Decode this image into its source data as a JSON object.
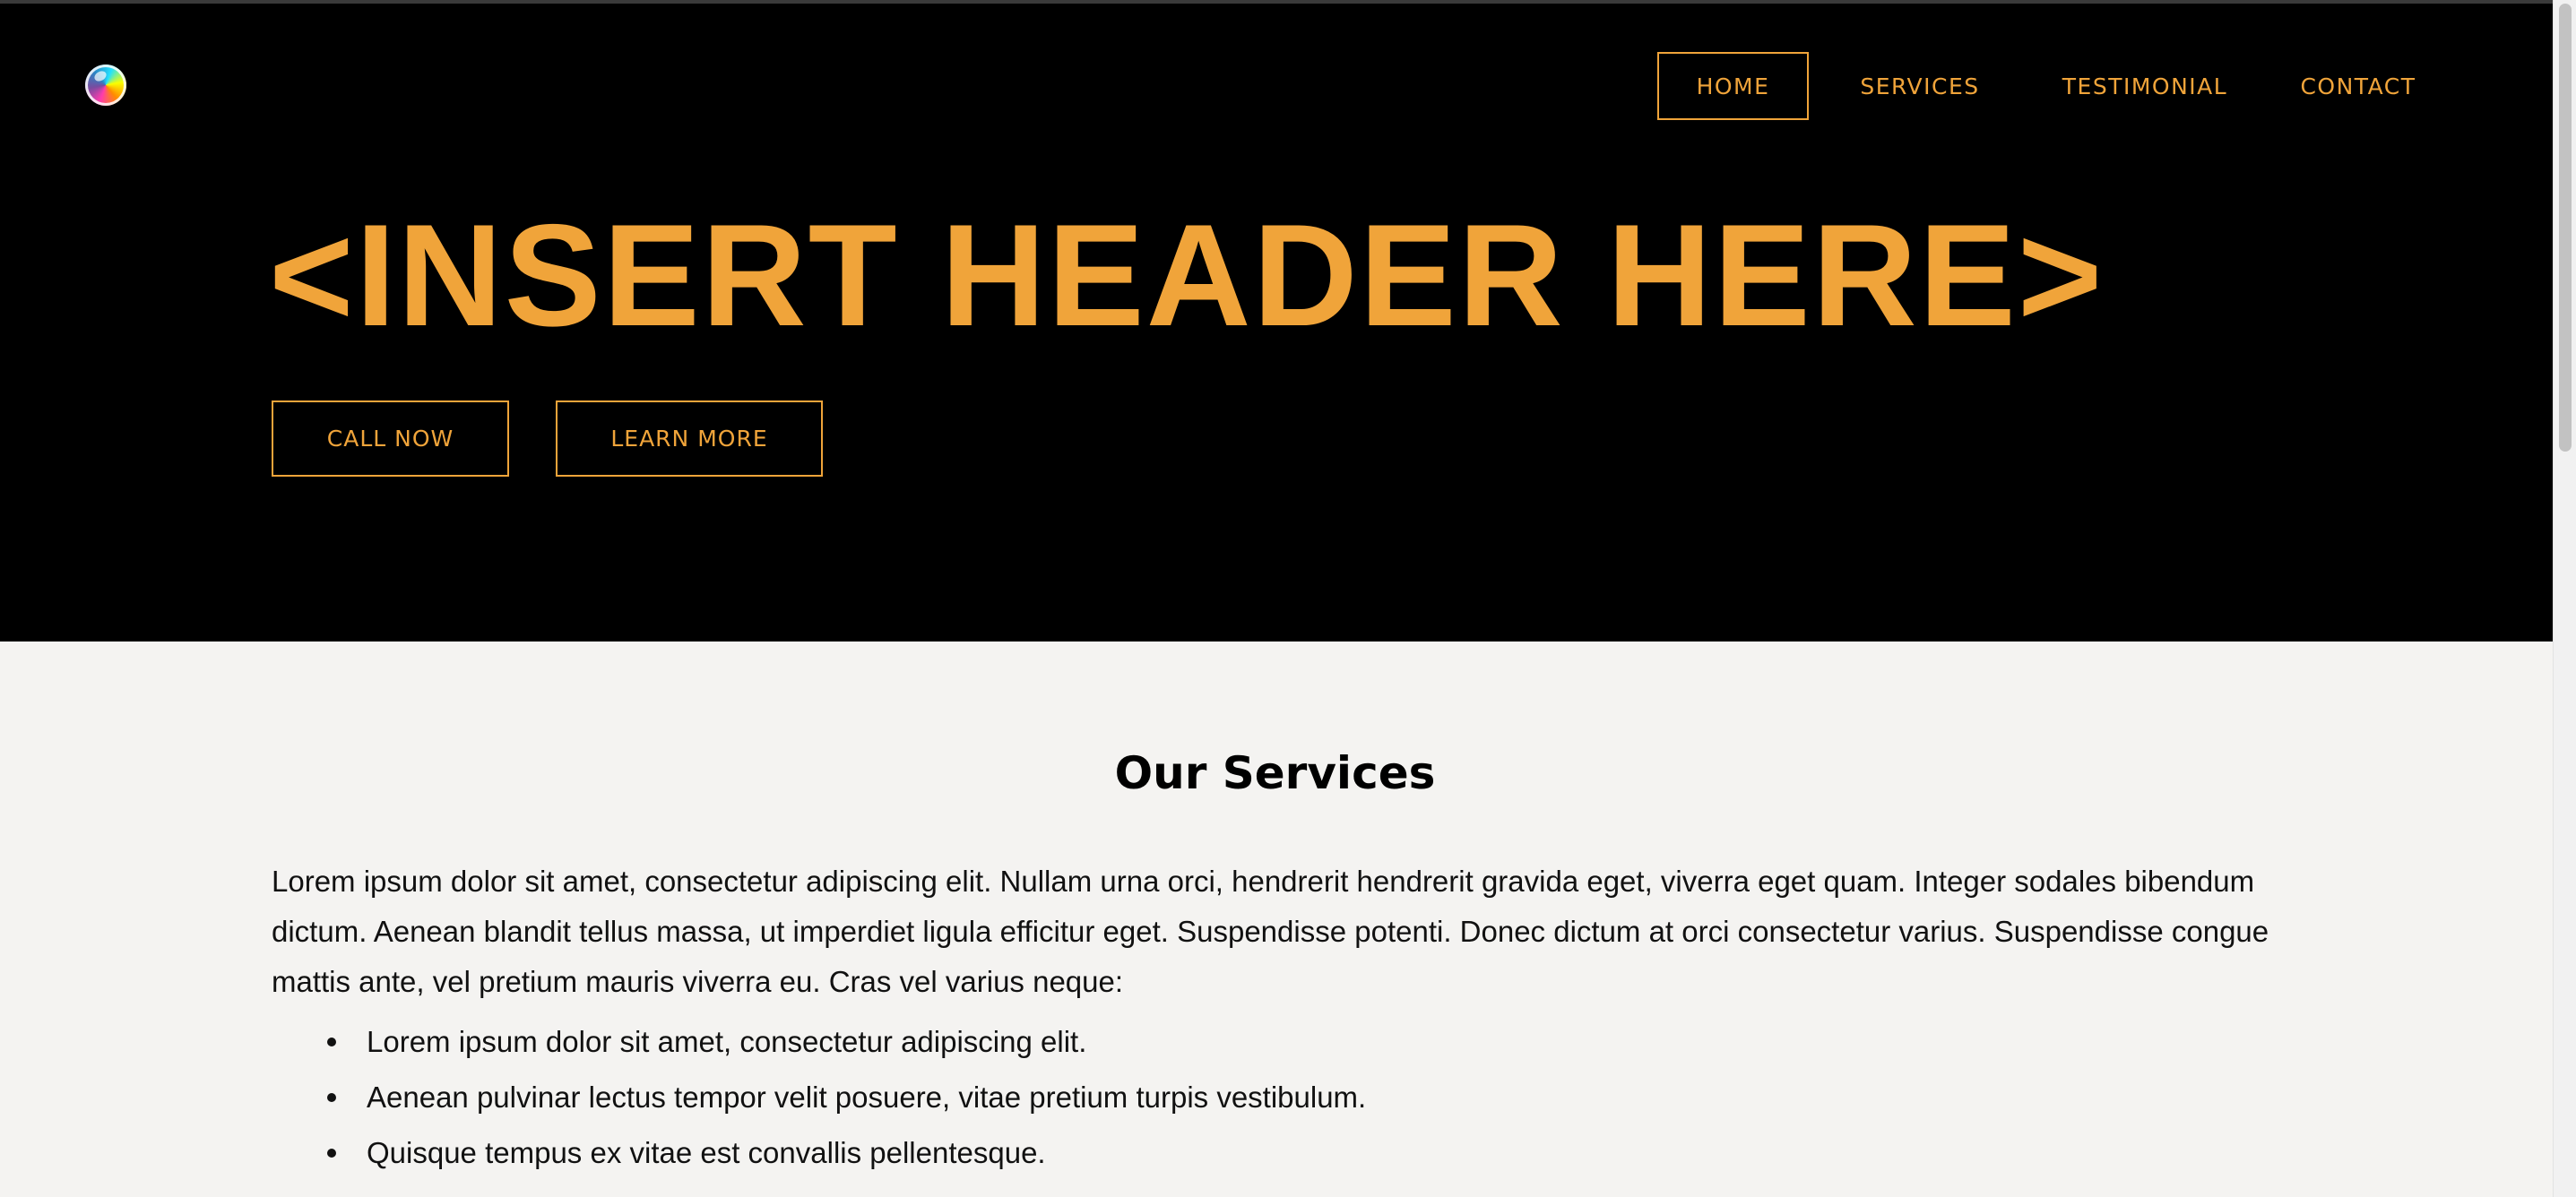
{
  "header": {
    "logo_icon": "gradient-orb-logo",
    "nav": [
      {
        "label": "HOME",
        "active": true
      },
      {
        "label": "SERVICES",
        "active": false
      },
      {
        "label": "TESTIMONIAL",
        "active": false
      },
      {
        "label": "CONTACT",
        "active": false
      }
    ]
  },
  "hero": {
    "title": "<INSERT HEADER HERE>",
    "call_label": "CALL NOW",
    "learn_label": "LEARN MORE"
  },
  "services": {
    "title": "Our Services",
    "paragraph": "Lorem ipsum dolor sit amet, consectetur adipiscing elit. Nullam urna orci, hendrerit hendrerit gravida eget, viverra eget quam. Integer sodales bibendum dictum. Aenean blandit tellus massa, ut imperdiet ligula efficitur eget. Suspendisse potenti. Donec dictum at orci consectetur varius. Suspendisse congue mattis ante, vel pretium mauris viverra eu. Cras vel varius neque:",
    "items": [
      "Lorem ipsum dolor sit amet, consectetur adipiscing elit.",
      "Aenean pulvinar lectus tempor velit posuere, vitae pretium turpis vestibulum.",
      "Quisque tempus ex vitae est convallis pellentesque."
    ]
  },
  "colors": {
    "accent": "#f0a43a",
    "hero_bg": "#000000",
    "section_bg": "#f4f3f1",
    "text": "#111111"
  }
}
